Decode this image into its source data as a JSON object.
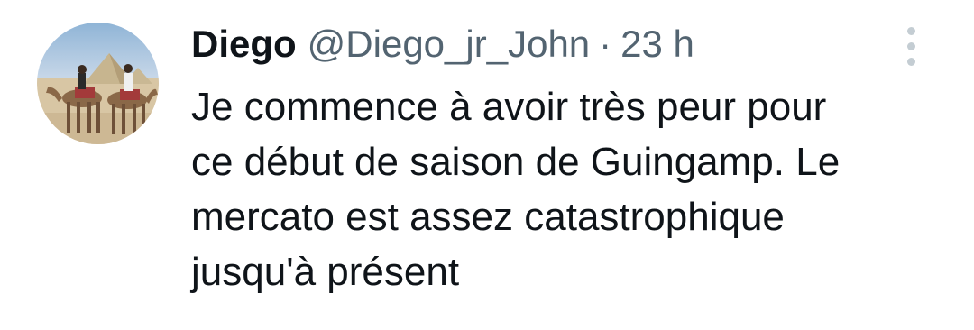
{
  "tweet": {
    "display_name": "Diego",
    "handle": "@Diego_jr_John",
    "separator": "·",
    "time": "23 h",
    "text_lines": [
      "Je commence à avoir très peur pour",
      "ce début de saison de Guingamp. Le",
      "mercato est assez catastrophique",
      "jusqu'à présent"
    ],
    "avatar_icon": "profile-photo-camels-pyramids",
    "more_icon": "more-vertical-icon"
  },
  "colors": {
    "text_primary": "#0f1419",
    "text_secondary": "#536471",
    "more_dots": "#c4cdd3",
    "background": "#ffffff"
  }
}
